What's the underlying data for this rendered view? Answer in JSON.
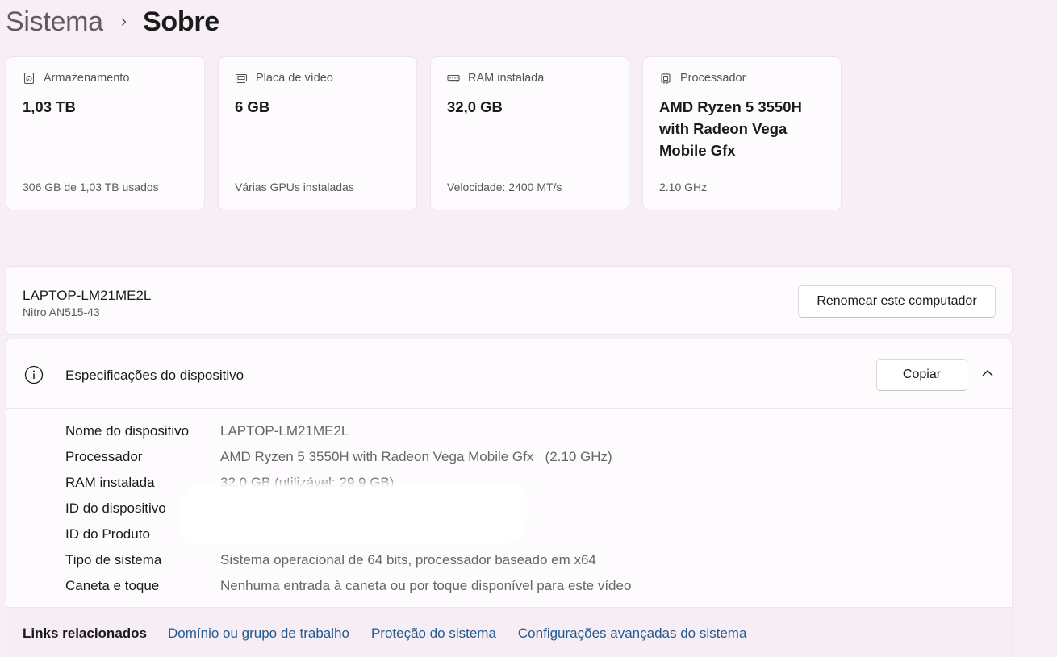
{
  "breadcrumb": {
    "parent": "Sistema",
    "separator": "›",
    "current": "Sobre"
  },
  "cards": [
    {
      "icon": "storage-icon",
      "title": "Armazenamento",
      "value": "1,03 TB",
      "sub": "306 GB de 1,03 TB usados"
    },
    {
      "icon": "gpu-icon",
      "title": "Placa de vídeo",
      "value": "6 GB",
      "sub": "Várias GPUs instaladas"
    },
    {
      "icon": "ram-icon",
      "title": "RAM instalada",
      "value": "32,0 GB",
      "sub": "Velocidade: 2400 MT/s"
    },
    {
      "icon": "cpu-icon",
      "title": "Processador",
      "value": "AMD Ryzen 5 3550H with Radeon Vega Mobile Gfx",
      "sub": "2.10 GHz"
    }
  ],
  "device": {
    "name": "LAPTOP-LM21ME2L",
    "model": "Nitro AN515-43",
    "rename_label": "Renomear este computador"
  },
  "specs": {
    "title": "Especificações do dispositivo",
    "copy_label": "Copiar",
    "rows": [
      {
        "label": "Nome do dispositivo",
        "value": "LAPTOP-LM21ME2L"
      },
      {
        "label": "Processador",
        "value": "AMD Ryzen 5 3550H with Radeon Vega Mobile Gfx   (2.10 GHz)"
      },
      {
        "label": "RAM instalada",
        "value": "32,0 GB (utilizável: 29,9 GB)"
      },
      {
        "label": "ID do dispositivo",
        "value": ""
      },
      {
        "label": "ID do Produto",
        "value": ""
      },
      {
        "label": "Tipo de sistema",
        "value": "Sistema operacional de 64 bits, processador baseado em x64"
      },
      {
        "label": "Caneta e toque",
        "value": "Nenhuma entrada à caneta ou por toque disponível para este vídeo"
      }
    ]
  },
  "links": {
    "label": "Links relacionados",
    "items": [
      "Domínio ou grupo de trabalho",
      "Proteção do sistema",
      "Configurações avançadas do sistema"
    ]
  },
  "colors": {
    "background": "#f8eef6",
    "card": "#fdfbfd",
    "link": "#245a8f"
  }
}
